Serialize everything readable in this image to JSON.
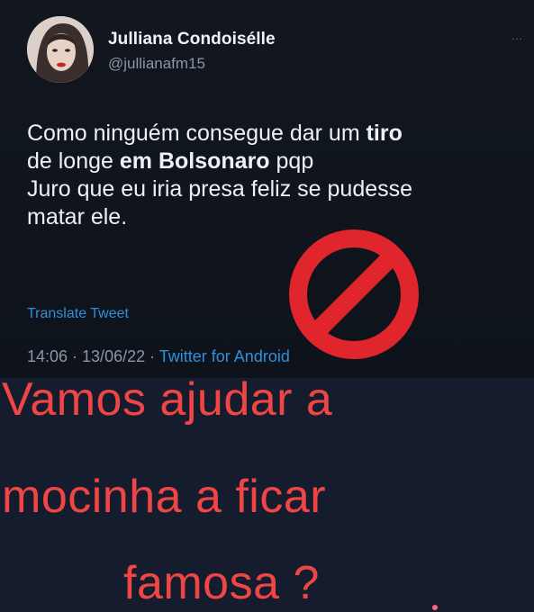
{
  "tweet": {
    "display_name": "Julliana Condoisélle",
    "handle": "@jullianafm15",
    "more_label": "...",
    "text": {
      "line1_normal": "Como ninguém consegue dar um ",
      "line1_bold": "tiro",
      "line2_normal1": "de longe ",
      "line2_bold": "em Bolsonaro",
      "line2_normal2": " pqp",
      "line3": "Juro que eu iria presa feliz se pudesse",
      "line4": "matar ele."
    },
    "translate_label": "Translate Tweet",
    "timestamp": "14:06 · 13/06/22 · ",
    "source": "Twitter for Android"
  },
  "overlay": {
    "caption_line1": "Vamos ajudar a",
    "caption_line2": "mocinha a ficar",
    "caption_line3": "famosa ?"
  },
  "colors": {
    "tweet_bg": "#12171f",
    "caption_red": "#ef4645",
    "link_blue": "#2f8fdc",
    "forbidden_red": "#e0252c"
  },
  "icons": {
    "avatar": "profile-photo",
    "forbidden": "prohibited-sign-icon"
  }
}
